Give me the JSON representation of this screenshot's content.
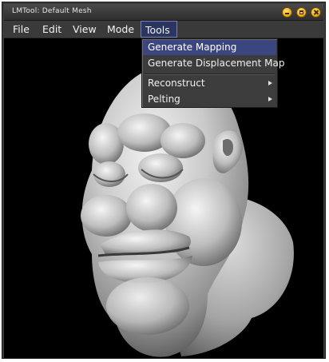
{
  "window": {
    "title": "LMTool: Default Mesh"
  },
  "menubar": {
    "items": [
      {
        "label": "File"
      },
      {
        "label": "Edit"
      },
      {
        "label": "View"
      },
      {
        "label": "Mode"
      },
      {
        "label": "Tools"
      }
    ],
    "active": "Tools"
  },
  "tools_menu": {
    "items": [
      {
        "label": "Generate Mapping",
        "selected": true,
        "submenu": false
      },
      {
        "label": "Generate Displacement Map",
        "selected": false,
        "submenu": false
      },
      {
        "label": "Reconstruct",
        "selected": false,
        "submenu": true
      },
      {
        "label": "Pelting",
        "selected": false,
        "submenu": true
      }
    ]
  },
  "viewport": {
    "content": "3d-mesh-render"
  },
  "icons": {
    "minimize": "minimize-icon",
    "maximize": "maximize-icon",
    "close": "close-icon",
    "submenu": "chevron-right-icon"
  },
  "colors": {
    "menu_highlight": "#3b4680",
    "window_button": "#f0b21e",
    "viewport_bg": "#000000",
    "chrome": "#3a3a3a"
  }
}
